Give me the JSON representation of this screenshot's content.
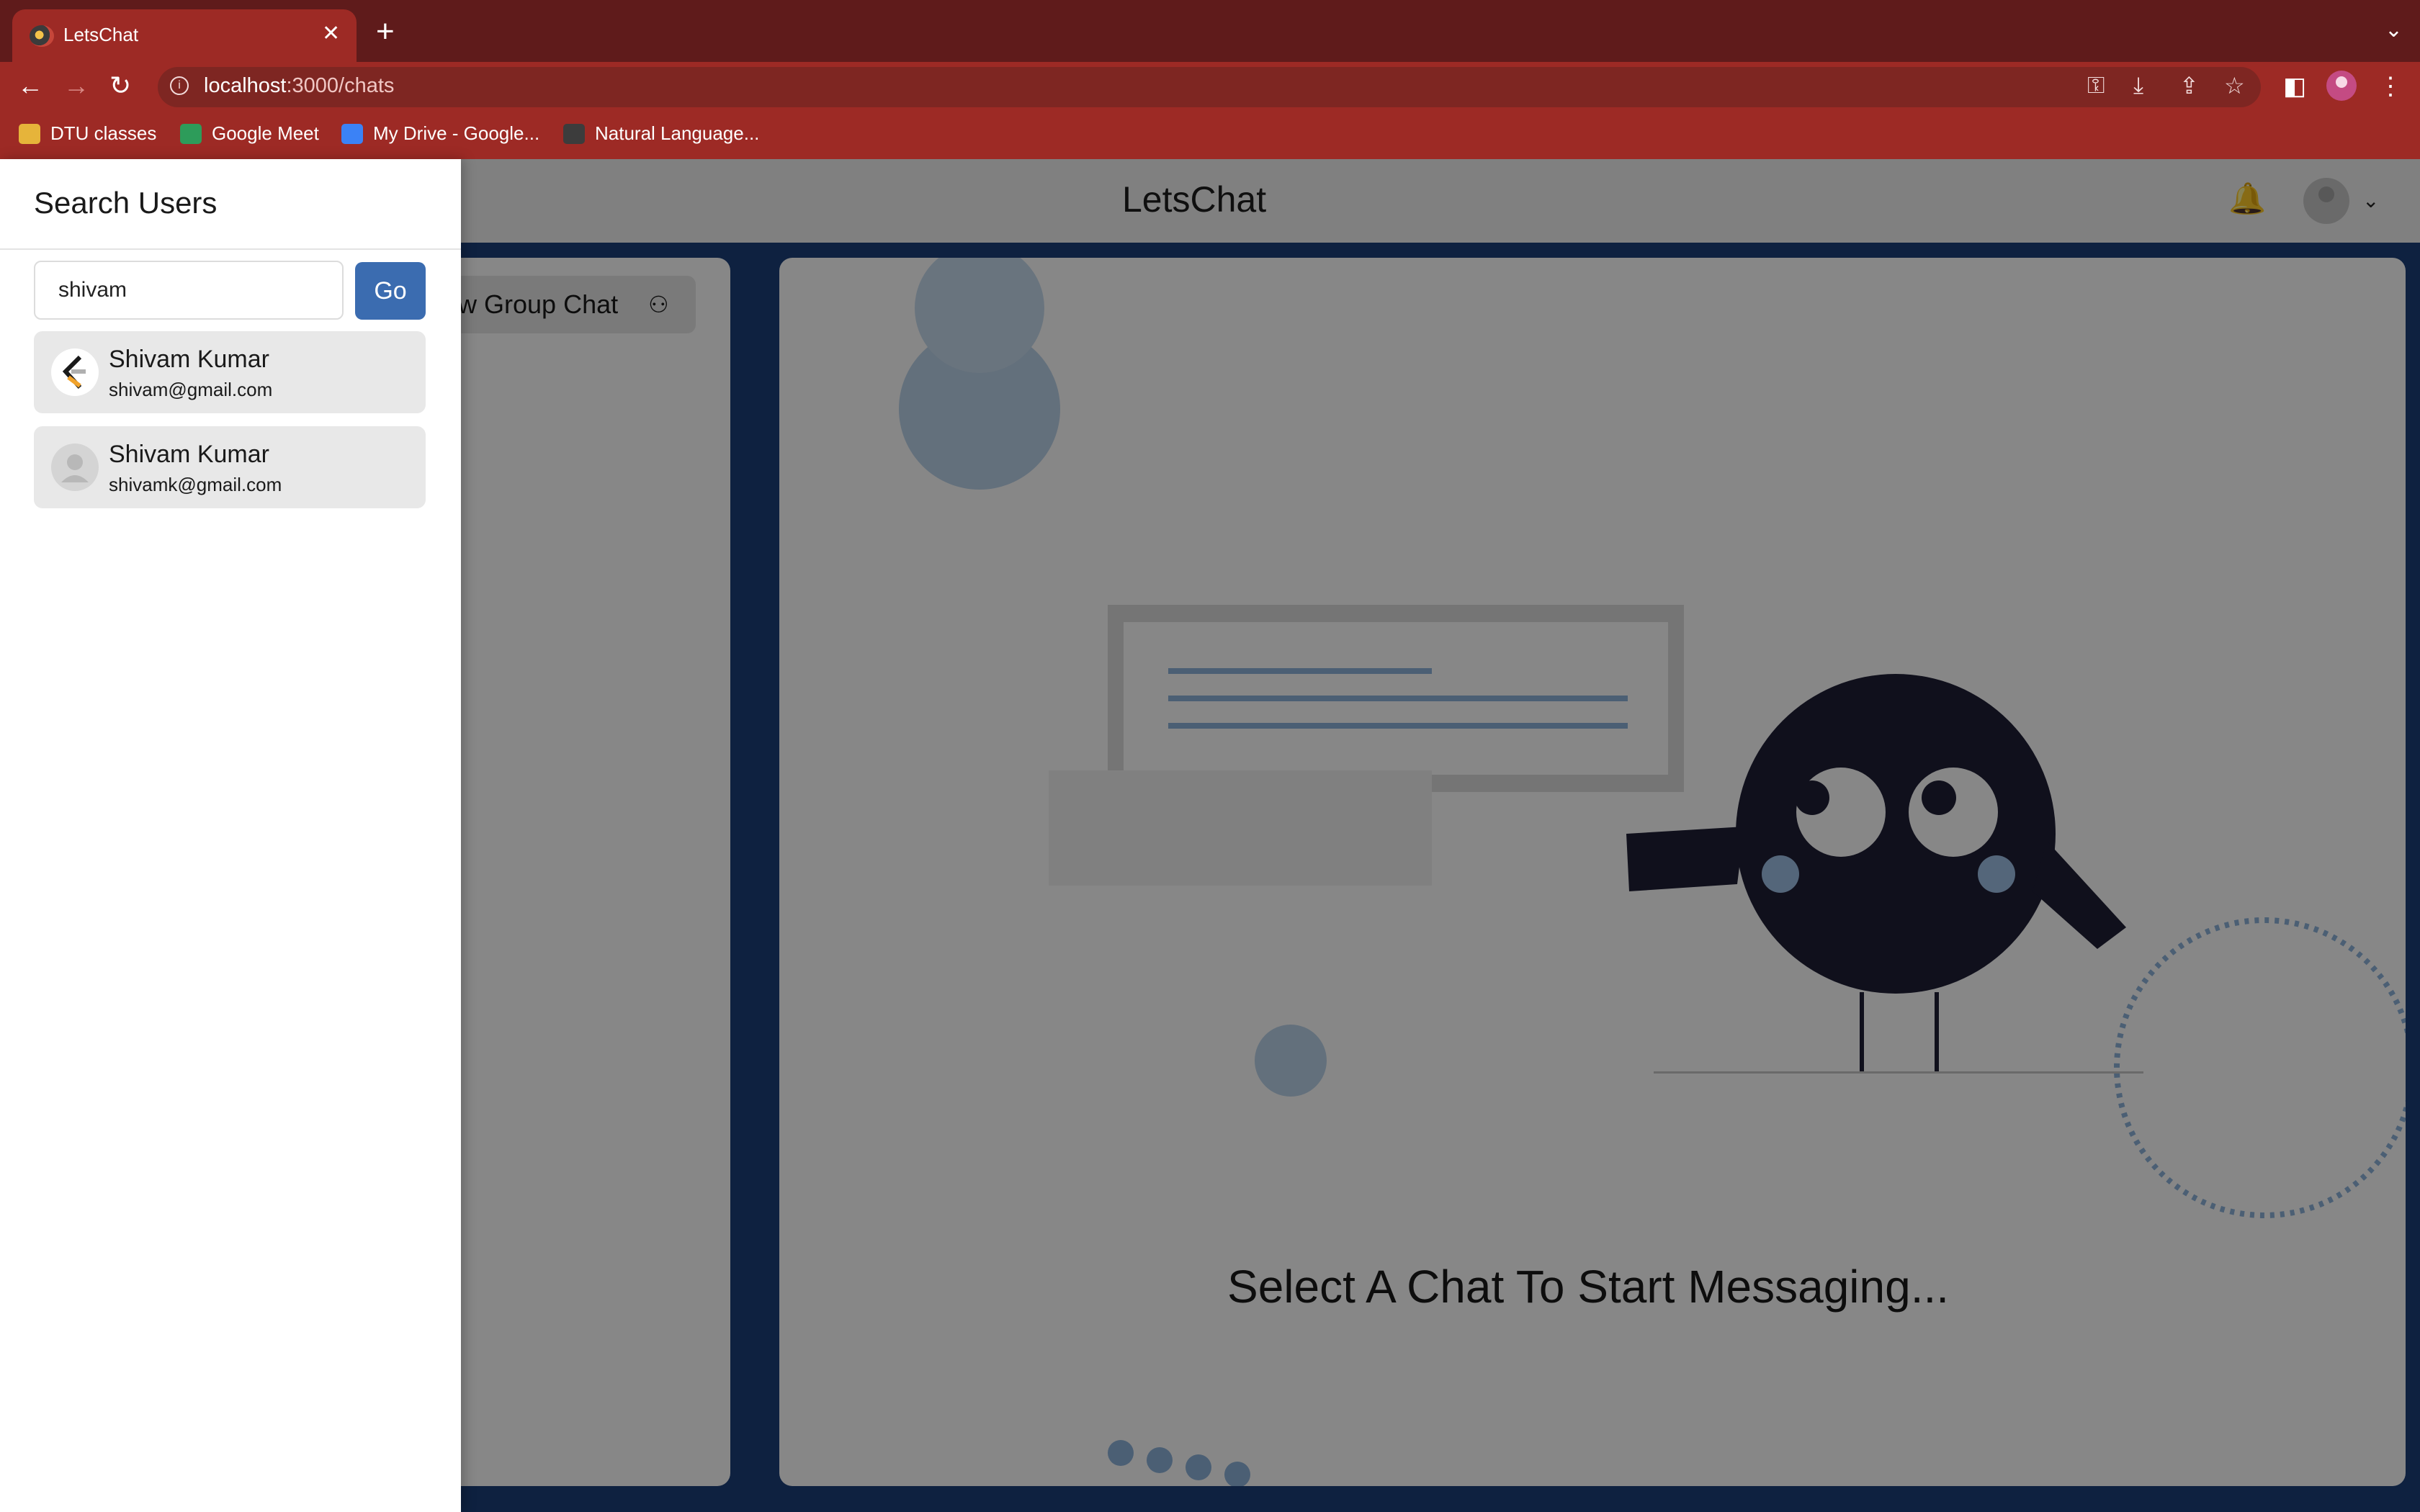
{
  "browser": {
    "tab_title": "LetsChat",
    "url_host": "localhost",
    "url_path": ":3000/chats",
    "bookmarks": [
      {
        "label": "DTU classes",
        "color": "#e6b43a"
      },
      {
        "label": "Google Meet",
        "color": "#2d9c5a"
      },
      {
        "label": "My Drive - Google...",
        "color": "#3b82f6"
      },
      {
        "label": "Natural Language...",
        "color": "#3c3c3c"
      }
    ],
    "icons": {
      "back": "←",
      "forward": "→",
      "reload": "↻",
      "key": "⚿",
      "download": "⤓",
      "share": "⇪",
      "star": "☆",
      "sidepanel": "◧",
      "menu": "⋮",
      "close": "✕",
      "new_tab": "+",
      "tab_menu": "⌄"
    }
  },
  "app": {
    "title": "LetsChat",
    "new_group_chat": "ew Group Chat",
    "empty_state": "Select A Chat To Start Messaging...",
    "bell_icon": "🔔",
    "chevron": "⌄",
    "group_icon": "⚇"
  },
  "drawer": {
    "title": "Search Users",
    "search_value": "shivam",
    "go_label": "Go",
    "results": [
      {
        "name": "Shivam Kumar",
        "email": "shivam@gmail.com",
        "avatar": "logo"
      },
      {
        "name": "Shivam Kumar",
        "email": "shivamk@gmail.com",
        "avatar": "default"
      }
    ]
  },
  "colors": {
    "tab_strip": "#5f1b1b",
    "toolbar": "#9d2a25",
    "accent_button": "#3b6cb0",
    "app_bg": "#1b3f7a"
  }
}
